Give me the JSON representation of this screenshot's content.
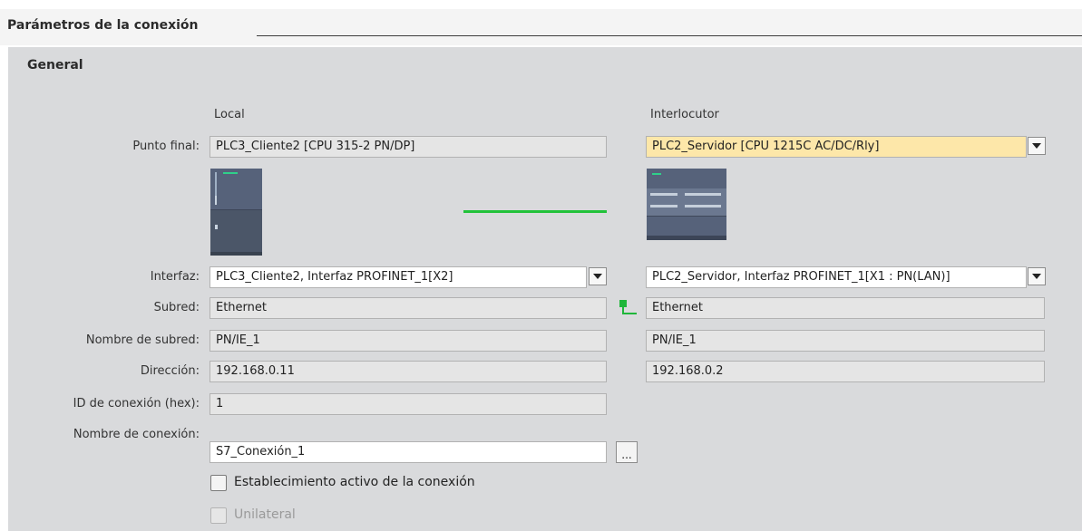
{
  "header": {
    "title": "Parámetros de la conexión"
  },
  "section": {
    "title": "General"
  },
  "columns": {
    "local": "Local",
    "partner": "Interlocutor"
  },
  "labels": {
    "endpoint": "Punto final:",
    "interface": "Interfaz:",
    "subnet": "Subred:",
    "subnet_name": "Nombre de subred:",
    "address": "Dirección:",
    "connection_id": "ID de conexión (hex):",
    "connection_name": "Nombre de conexión:"
  },
  "local": {
    "endpoint": "PLC3_Cliente2 [CPU 315-2 PN/DP]",
    "interface": "PLC3_Cliente2, Interfaz PROFINET_1[X2]",
    "subnet": "Ethernet",
    "subnet_name": "PN/IE_1",
    "address": "192.168.0.11",
    "connection_id": "1",
    "connection_name": "S7_Conexión_1"
  },
  "partner": {
    "endpoint": "PLC2_Servidor [CPU 1215C AC/DC/Rly]",
    "interface": "PLC2_Servidor, Interfaz PROFINET_1[X1 : PN(LAN)]",
    "subnet": "Ethernet",
    "subnet_name": "PN/IE_1",
    "address": "192.168.0.2"
  },
  "browse_button": {
    "label": "..."
  },
  "options": {
    "active_connection": {
      "label": "Establecimiento activo de la conexión",
      "checked": false
    },
    "unilateral": {
      "label": "Unilateral",
      "checked": false,
      "disabled": true
    }
  },
  "colors": {
    "link_line": "#22c23a",
    "highlight_field": "#fde7a9",
    "panel_bg": "#d9dadc"
  },
  "icons": {
    "browse": "ellipsis-icon",
    "network": "network-link-icon",
    "dropdown": "chevron-down-icon"
  }
}
